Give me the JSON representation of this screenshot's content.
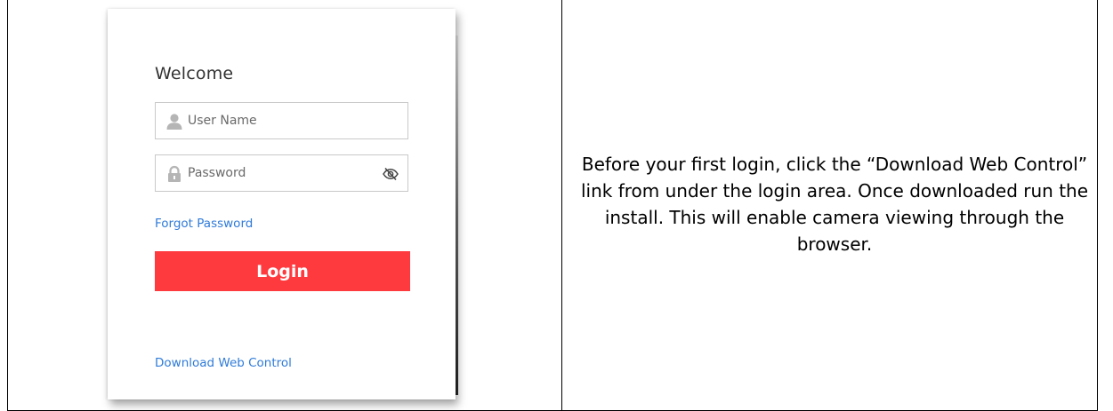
{
  "login_card": {
    "title": "Welcome",
    "username_placeholder": "User Name",
    "password_placeholder": "Password",
    "forgot_password_label": "Forgot Password",
    "login_button_label": "Login",
    "download_web_control_label": "Download Web Control",
    "icons": {
      "username": "user-icon",
      "password": "lock-icon",
      "password_toggle": "eye-hidden-icon"
    },
    "colors": {
      "login_button": "#ff3a3f",
      "link": "#2f7bd9"
    }
  },
  "instructions": {
    "text": "Before your first login, click the “Download Web Control” link from under the login area. Once downloaded run the install. This will enable camera viewing through the browser."
  }
}
